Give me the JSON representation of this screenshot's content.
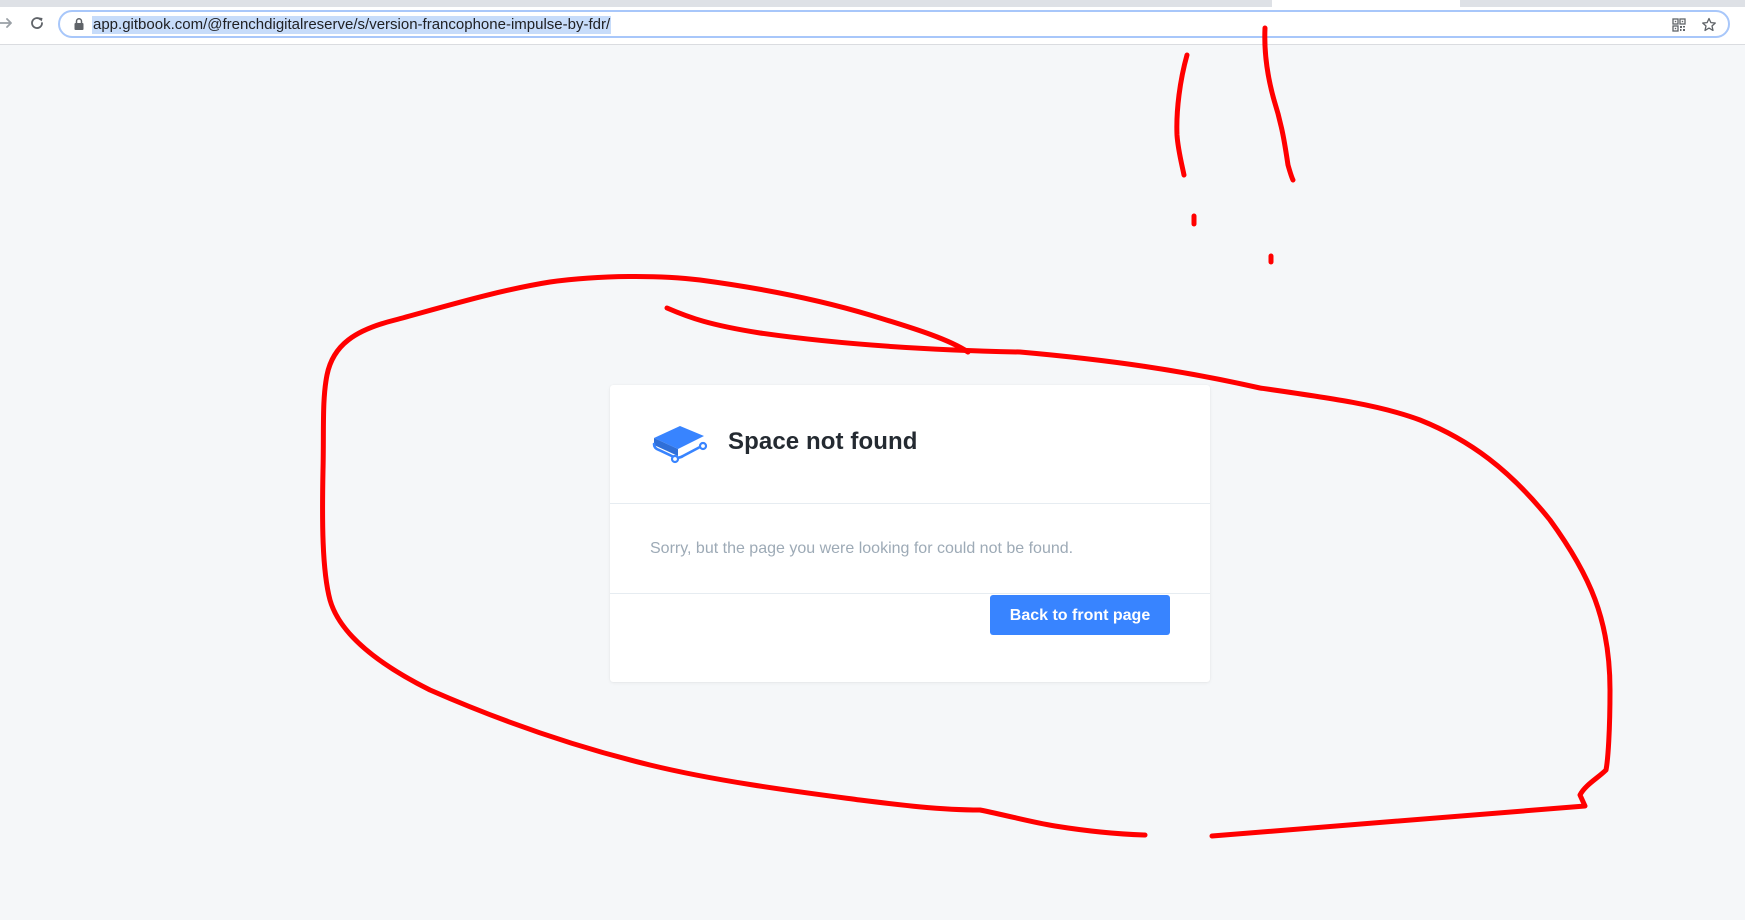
{
  "browser": {
    "url": "app.gitbook.com/@frenchdigitalreserve/s/version-francophone-impulse-by-fdr/",
    "icons": {
      "forward": "forward-arrow-icon",
      "reload": "reload-icon",
      "lock": "lock-icon",
      "qr": "qr-code-icon",
      "bookmark": "star-icon"
    },
    "colors": {
      "omnibox_border": "#a8c7fa",
      "url_highlight": "#c7dcfa"
    }
  },
  "card": {
    "icon": "gitbook-book-icon",
    "title": "Space not found",
    "message": "Sorry, but the page you were looking for could not be found.",
    "button_label": "Back to front page",
    "colors": {
      "accent": "#3884ff",
      "title": "#242a31",
      "message": "#9daab6"
    }
  },
  "annotations": {
    "color": "#ff0000",
    "description_shape": "hand-drawn-loop"
  }
}
